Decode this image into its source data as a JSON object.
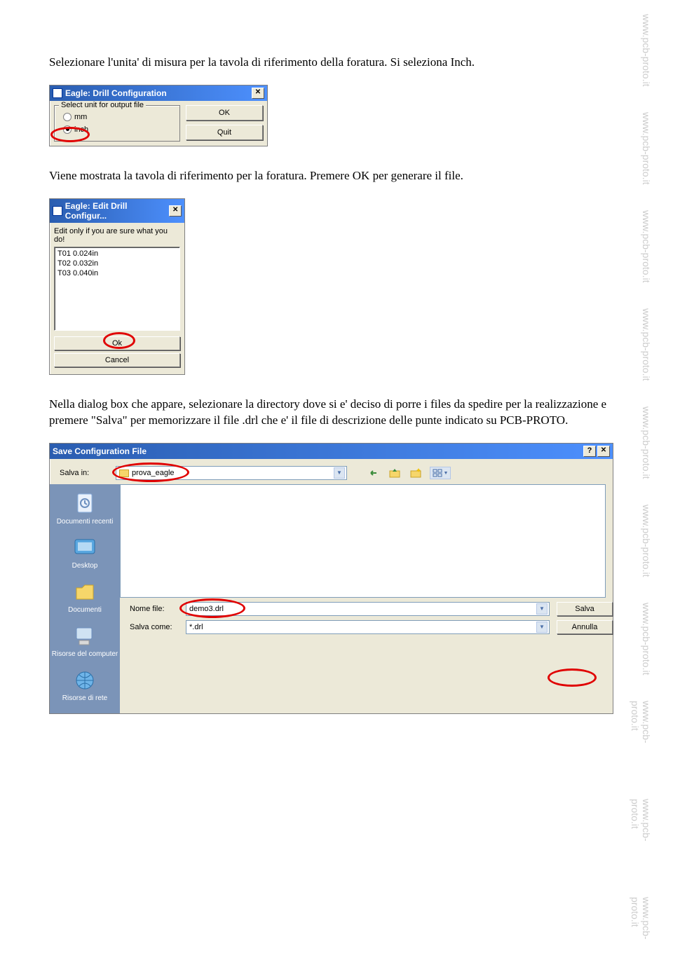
{
  "watermark": "www.pcb-proto.it",
  "para1": "Selezionare l'unita' di misura per la tavola di riferimento della foratura. Si seleziona Inch.",
  "para2": "Viene mostrata la tavola di riferimento per la foratura. Premere OK per generare il file.",
  "para3": "Nella dialog box che appare, selezionare la directory dove si e' deciso di porre i files da spedire per la realizzazione e premere \"Salva\" per memorizzare il file .drl che e' il file di descrizione delle punte indicato su PCB-PROTO.",
  "dlg1": {
    "title": "Eagle: Drill Configuration",
    "group_label": "Select unit for output file",
    "opt_mm": "mm",
    "opt_inch": "inch",
    "btn_ok": "OK",
    "btn_quit": "Quit"
  },
  "dlg2": {
    "title": "Eagle: Edit Drill Configur...",
    "hint": "Edit only if you are sure what you do!",
    "items": [
      "T01 0.024in",
      "T02 0.032in",
      "T03 0.040in"
    ],
    "btn_ok": "Ok",
    "btn_cancel": "Cancel"
  },
  "dlg3": {
    "title": "Save Configuration File",
    "label_salva_in": "Salva in:",
    "folder": "prova_eagle",
    "shortcuts": {
      "recent": "Documenti recenti",
      "desktop": "Desktop",
      "documents": "Documenti",
      "computer": "Risorse del computer",
      "network": "Risorse di rete"
    },
    "label_nome": "Nome file:",
    "val_nome": "demo3.drl",
    "label_tipo": "Salva come:",
    "val_tipo": "*.drl",
    "btn_salva": "Salva",
    "btn_annulla": "Annulla"
  }
}
